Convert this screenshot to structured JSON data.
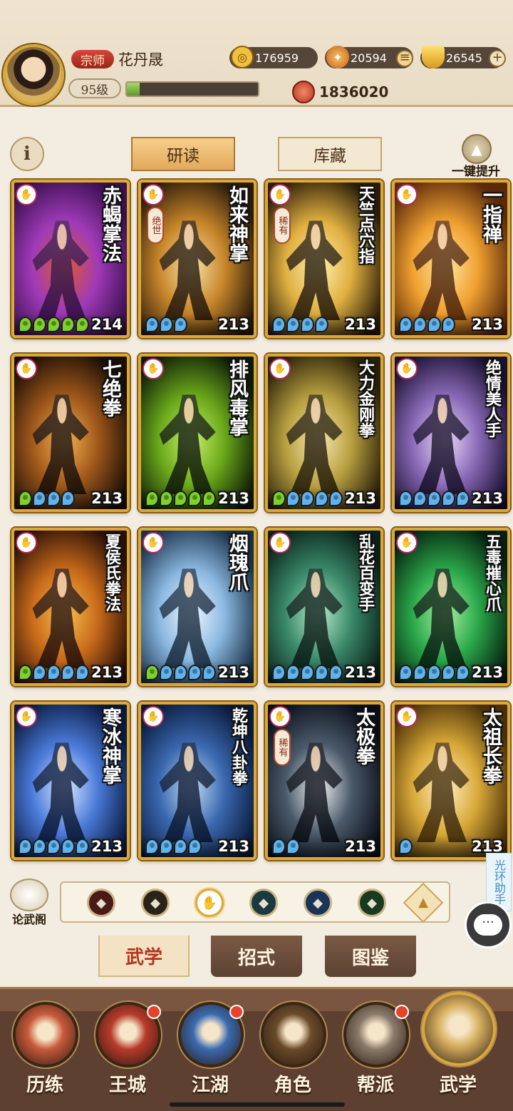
{
  "player": {
    "rank": "宗师",
    "name": "花丹晟",
    "level": "95级",
    "exp_fraction": 0.1,
    "power": "1836020"
  },
  "resources": [
    {
      "icon": "coin-icon",
      "value": "176959"
    },
    {
      "icon": "spirit-fire-icon",
      "value": "20594"
    },
    {
      "icon": "gold-ingot-icon",
      "value": "26545"
    }
  ],
  "tabs": {
    "read": "研读",
    "collection": "库藏",
    "upgrade_label": "一键提升"
  },
  "colors": {
    "accent_gold": "#d9a93c",
    "star_green": "#7cd22a",
    "star_blue": "#5fb4f0",
    "rank_red": "#c8362a"
  },
  "cards": [
    {
      "title": "赤蝎掌法",
      "rarity": "",
      "green": 5,
      "blue": 0,
      "level": "214",
      "bg": [
        "#3a1050",
        "#a03ab8",
        "#e05a2a"
      ]
    },
    {
      "title": "如来神掌",
      "rarity": "绝世",
      "green": 0,
      "blue": 3,
      "level": "213",
      "bg": [
        "#2a1a0a",
        "#c8862a",
        "#f6e2a8"
      ]
    },
    {
      "title": "天竺点穴指",
      "rarity": "稀有",
      "green": 0,
      "blue": 4,
      "level": "213",
      "bg": [
        "#2a1c08",
        "#e0b040",
        "#fff0b0"
      ]
    },
    {
      "title": "一指禅",
      "rarity": "",
      "green": 0,
      "blue": 4,
      "level": "213",
      "bg": [
        "#5a2a0a",
        "#f0a030",
        "#ffe6a0"
      ]
    },
    {
      "title": "七绝拳",
      "rarity": "",
      "green": 1,
      "blue": 3,
      "level": "213",
      "bg": [
        "#1a0e06",
        "#a0581a",
        "#f6b050"
      ]
    },
    {
      "title": "排风毒掌",
      "rarity": "",
      "green": 5,
      "blue": 0,
      "level": "213",
      "bg": [
        "#0e1a06",
        "#6aa81a",
        "#c8f06a"
      ]
    },
    {
      "title": "大力金刚拳",
      "rarity": "",
      "green": 1,
      "blue": 4,
      "level": "213",
      "bg": [
        "#2a2008",
        "#b8a040",
        "#f6e8b0"
      ]
    },
    {
      "title": "绝情美人手",
      "rarity": "",
      "green": 0,
      "blue": 5,
      "level": "213",
      "bg": [
        "#1a1030",
        "#8a6ab8",
        "#e8d8f6"
      ]
    },
    {
      "title": "夏侯氏拳法",
      "rarity": "",
      "green": 1,
      "blue": 4,
      "level": "213",
      "bg": [
        "#2a1006",
        "#c86a1a",
        "#f6c050"
      ]
    },
    {
      "title": "烟瑰爪",
      "rarity": "",
      "green": 1,
      "blue": 4,
      "level": "213",
      "bg": [
        "#1a3048",
        "#8ab8e0",
        "#f0f6ff"
      ]
    },
    {
      "title": "乱花百变手",
      "rarity": "",
      "green": 0,
      "blue": 5,
      "level": "213",
      "bg": [
        "#0a2018",
        "#3a8a6a",
        "#b8e8c8"
      ]
    },
    {
      "title": "五毒摧心爪",
      "rarity": "",
      "green": 0,
      "blue": 5,
      "level": "213",
      "bg": [
        "#062010",
        "#2aa84a",
        "#a8f0a0"
      ]
    },
    {
      "title": "寒冰神掌",
      "rarity": "",
      "green": 0,
      "blue": 5,
      "level": "213",
      "bg": [
        "#0a1a40",
        "#4a7ad8",
        "#d8e8ff"
      ]
    },
    {
      "title": "乾坤八卦拳",
      "rarity": "",
      "green": 0,
      "blue": 4,
      "level": "213",
      "bg": [
        "#0a1a3a",
        "#3a68b0",
        "#c0d8f0"
      ]
    },
    {
      "title": "太极拳",
      "rarity": "稀有",
      "green": 0,
      "blue": 2,
      "level": "213",
      "bg": [
        "#0a0e18",
        "#4a5a6a",
        "#f0f0f0"
      ]
    },
    {
      "title": "太祖长拳",
      "rarity": "",
      "green": 0,
      "blue": 1,
      "level": "213",
      "bg": [
        "#4a3008",
        "#d8a838",
        "#fff0c0"
      ]
    }
  ],
  "lunwuge_label": "论武阁",
  "filters": [
    {
      "icon": "saber-school-icon",
      "color": "#4a1a14"
    },
    {
      "icon": "staff-school-icon",
      "color": "#2a2418"
    },
    {
      "icon": "palm-school-icon",
      "color": "#b42a5c",
      "selected": true
    },
    {
      "icon": "fan-school-icon",
      "color": "#1a3a40"
    },
    {
      "icon": "taiji-school-icon",
      "color": "#1a3458"
    },
    {
      "icon": "poison-school-icon",
      "color": "#1a3a20"
    }
  ],
  "assist_label": "光环助手",
  "subtabs": {
    "martial": "武学",
    "moves": "招式",
    "codex": "图鉴"
  },
  "nav": [
    {
      "label": "历练",
      "dot": false,
      "icon": "training-icon"
    },
    {
      "label": "王城",
      "dot": true,
      "icon": "royal-city-icon"
    },
    {
      "label": "江湖",
      "dot": true,
      "icon": "jianghu-icon"
    },
    {
      "label": "角色",
      "dot": false,
      "icon": "character-icon"
    },
    {
      "label": "帮派",
      "dot": true,
      "icon": "guild-icon"
    },
    {
      "label": "武学",
      "dot": false,
      "icon": "martial-scroll-icon",
      "active": true
    }
  ]
}
